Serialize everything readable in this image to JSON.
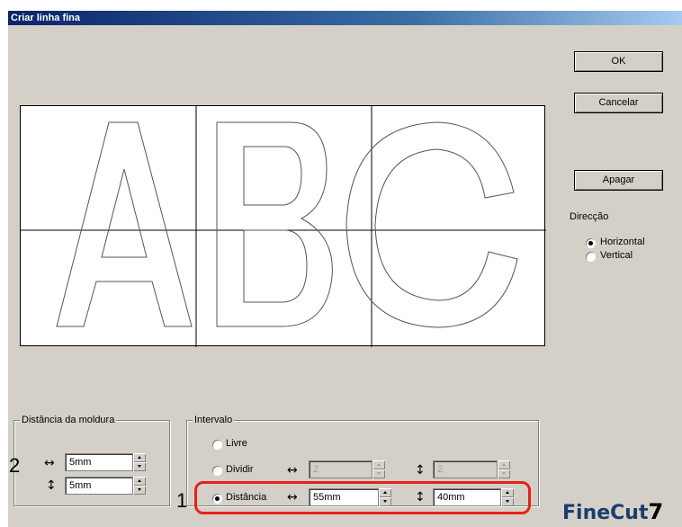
{
  "window": {
    "title": "Criar linha fina"
  },
  "buttons": {
    "ok": "OK",
    "cancel": "Cancelar",
    "delete": "Apagar"
  },
  "direction": {
    "label": "Direcção",
    "options": [
      {
        "label": "Horizontal",
        "selected": true
      },
      {
        "label": "Vertical",
        "selected": false
      }
    ]
  },
  "frame_distance": {
    "title": "Distância da moldura",
    "horizontal_value": "5mm",
    "vertical_value": "5mm"
  },
  "interval": {
    "title": "Intervalo",
    "options": {
      "free": "Livre",
      "divide": "Dividir",
      "distance": "Distância"
    },
    "selected": "distance",
    "divide_h": "2",
    "divide_v": "2",
    "distance_h": "55mm",
    "distance_v": "40mm"
  },
  "callouts": {
    "one": "1",
    "two": "2"
  },
  "preview": {
    "letters": "ABC"
  },
  "branding": {
    "logo": "FineCut",
    "logo_version": "7"
  },
  "colors": {
    "highlight": "#e8201a",
    "dialog_bg": "#d4d0c8",
    "title_bar": "#0a246a"
  }
}
